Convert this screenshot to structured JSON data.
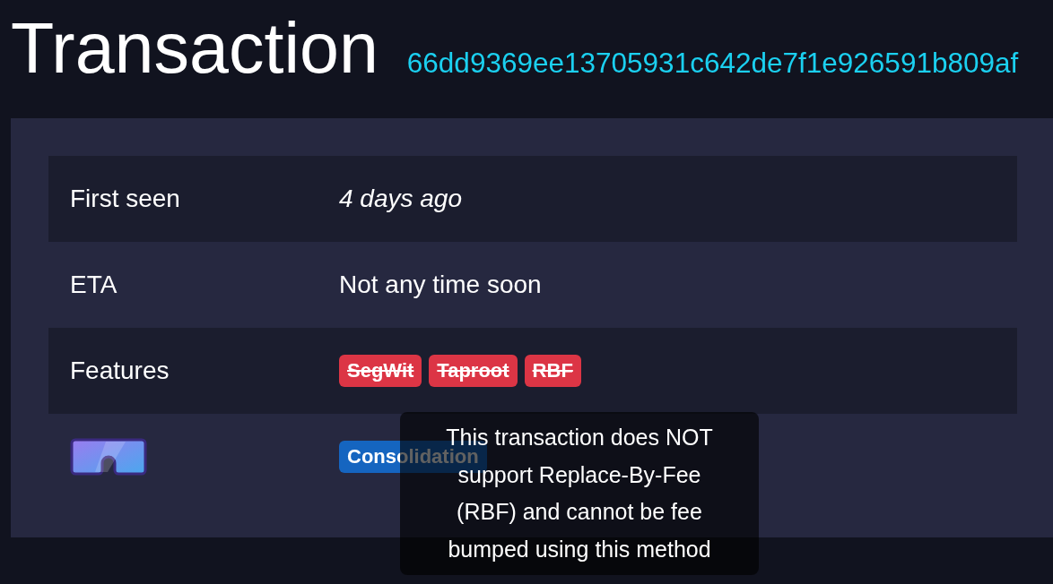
{
  "header": {
    "title": "Transaction",
    "txid": "66dd9369ee13705931c642de7f1e926591b809af"
  },
  "details": [
    {
      "kind": "text",
      "label": "First seen",
      "value": "4 days ago",
      "italic": true
    },
    {
      "kind": "text",
      "label": "ETA",
      "value": "Not any time soon",
      "italic": false
    },
    {
      "kind": "badges",
      "label": "Features",
      "badges": [
        {
          "text": "SegWit",
          "color": "#dc3545",
          "struck": true
        },
        {
          "text": "Taproot",
          "color": "#dc3545",
          "struck": true
        },
        {
          "text": "RBF",
          "color": "#dc3545",
          "struck": true,
          "hovered": true
        }
      ]
    },
    {
      "kind": "icon-badges",
      "badges": [
        {
          "text": "Consolidation",
          "color": "#1565c0",
          "struck": false
        }
      ]
    }
  ],
  "tooltip": {
    "text": "This transaction does NOT support Replace-By-Fee (RBF) and cannot be fee bumped using this method"
  }
}
